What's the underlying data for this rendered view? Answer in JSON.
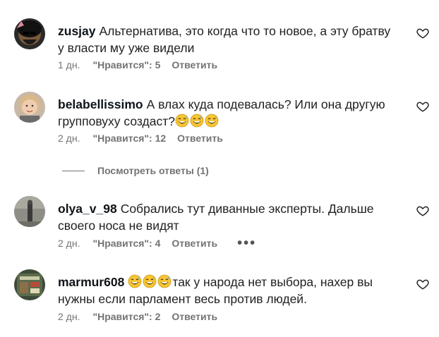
{
  "comments": [
    {
      "username": "zusjay",
      "text": "Альтернатива, это когда что то новое, а эту братву у власти му уже видели",
      "emojis": [],
      "time": "1 дн.",
      "likes": "\"Нравится\": 5",
      "reply": "Ответить"
    },
    {
      "username": "belabellissimo",
      "text": "А влах куда подевалась? Или она другую групповуху создаст?",
      "emojis": [
        "grinning-sweat-emoji",
        "grinning-sweat-emoji",
        "grinning-sweat-emoji"
      ],
      "time": "2 дн.",
      "likes": "\"Нравится\": 12",
      "reply": "Ответить"
    },
    {
      "username": "olya_v_98",
      "text": "Собрались тут диванные эксперты. Дальше своего носа не видят",
      "emojis": [],
      "time": "2 дн.",
      "likes": "\"Нравится\": 4",
      "reply": "Ответить",
      "more": "•••"
    },
    {
      "username": "marmur608",
      "text": "так у народа нет выбора, нахер вы нужны если парламент весь против людей.",
      "emojis": [
        "grinning-sweat-emoji",
        "grinning-sweat-emoji",
        "grinning-sweat-emoji"
      ],
      "time": "2 дн.",
      "likes": "\"Нравится\": 2",
      "reply": "Ответить"
    }
  ],
  "view_replies": "Посмотреть ответы (1)",
  "colors": {
    "text": "#1f1f1f",
    "meta": "#737373",
    "emoji_face": "#f7c533"
  }
}
